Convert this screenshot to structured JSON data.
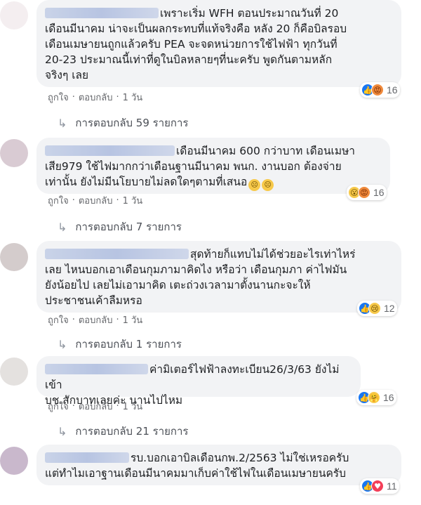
{
  "comments": [
    {
      "text_lines": [
        "เพราะเริ่ม WFH ตอนประมาณวันที่ 20",
        "เดือนมีนาคม น่าจะเป็นผลกระทบที่แท้จริงคือ หลัง 20 ก็คือบิลรอบ",
        "เดือนเมษายนถูกแล้วครับ PEA จะจดหน่วยการใช้ไฟฟ้า ทุกวันที่",
        "20-23 ประมาณนี้เท่าที่ดูในบิลหลายๆที่นะครับ พูดกันตามหลัก",
        "จริงๆ เลย"
      ],
      "reaction_count": "16",
      "reactions": [
        "like-icon",
        "angry-icon"
      ],
      "actions": {
        "like": "ถูกใจ",
        "reply": "ตอบกลับ",
        "time": "1 วัน"
      },
      "replies_label": "การตอบกลับ 59 รายการ",
      "avatar_color": "#f4eef0"
    },
    {
      "text_lines": [
        "เดือนมีนาคม 600 กว่าบาท เดือนเมษา",
        "เสีย979 ใช้ไฟมากกว่าเดือนฐานมีนาคม พนก. งานบอก ต้องจ่าย",
        "เท่านั้น ยังไม่มีนโยบายไม่ลดใดๆตามที่เสนอ"
      ],
      "inline_emojis": [
        "sad-emoji",
        "sad-emoji"
      ],
      "reaction_count": "16",
      "reactions": [
        "wow-icon",
        "angry-icon"
      ],
      "actions": {
        "like": "ถูกใจ",
        "reply": "ตอบกลับ",
        "time": "1 วัน"
      },
      "replies_label": "การตอบกลับ 7 รายการ",
      "avatar_color": "#d9cbd3"
    },
    {
      "text_lines": [
        "สุดท้ายก็แทบไม่ได้ช่วยอะไรเท่าไหร่",
        "เลย ไหนบอกเอาเดือนกุมภามาคิดไง หรือว่า เดือนกุมภา ค่าไฟมัน",
        "ยังน้อยไป เลยไม่เอามาคิด เตะถ่วงเวลามาตั้งนานกะจะให้",
        "ประชาชนเค้าลืมหรอ"
      ],
      "reaction_count": "12",
      "reactions": [
        "like-icon",
        "sad-icon"
      ],
      "actions": {
        "like": "ถูกใจ",
        "reply": "ตอบกลับ",
        "time": "1 วัน"
      },
      "replies_label": "การตอบกลับ 1 รายการ",
      "avatar_color": "#d4cccc"
    },
    {
      "text_lines": [
        "ค่ามิเตอร์ไฟฟ้าลงทะเบียน26/3/63 ยังไม่เข้า",
        "บช.สักบาทเลยค่ะ นานไปไหม"
      ],
      "reaction_count": "16",
      "reactions": [
        "like-icon",
        "care-icon"
      ],
      "actions": {
        "like": "ถูกใจ",
        "reply": "ตอบกลับ",
        "time": "1 วัน"
      },
      "replies_label": "การตอบกลับ 21 รายการ",
      "avatar_color": "#e4e1df"
    },
    {
      "text_lines": [
        "รบ.บอกเอาบิลเดือนกพ.2/2563 ไม่ใช่เหรอครับ",
        "แต่ทำไมเอาฐานเดือนมีนาคมมาเก็บค่าใช้ไฟในเดือนเมษายนครับ"
      ],
      "reaction_count": "11",
      "reactions": [
        "like-icon",
        "love-icon"
      ],
      "actions": {},
      "replies_label": "",
      "avatar_color": "#c9b8cc"
    }
  ]
}
